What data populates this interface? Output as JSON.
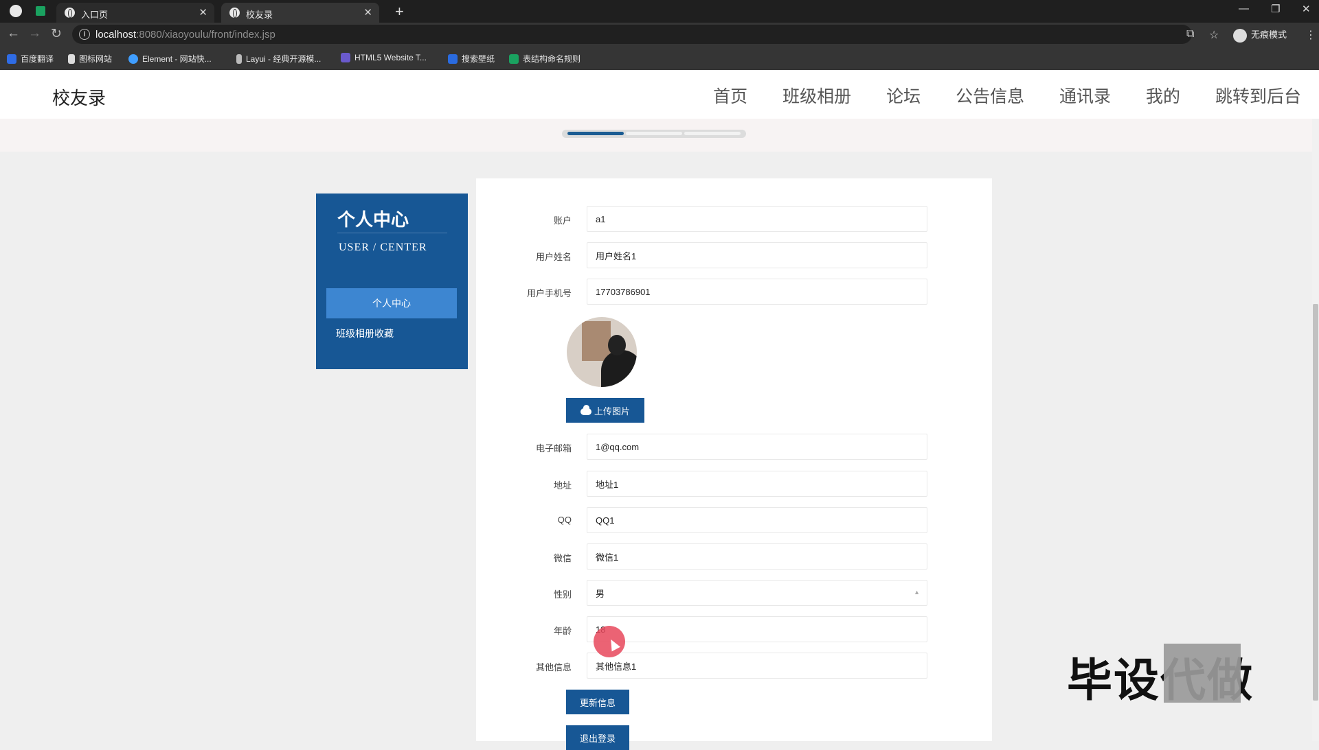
{
  "browser": {
    "tabs": [
      {
        "label": "入口页"
      },
      {
        "label": "校友录"
      }
    ],
    "new_tab_symbol": "+",
    "url_host": "localhost",
    "url_rest": ":8080/xiaoyoulu/front/index.jsp",
    "profile_label": "无痕模式",
    "bookmarks": [
      {
        "label": "百度翻译",
        "color": "#2f6ce5"
      },
      {
        "label": "图标网站",
        "color": "#ffffff"
      },
      {
        "label": "Element - 网站快...",
        "color": "#409eff"
      },
      {
        "label": "Layui - 经典开源模...",
        "color": "#ffffff"
      },
      {
        "label": "HTML5 Website T...",
        "color": "#6a5acd"
      },
      {
        "label": "搜索壁纸",
        "color": "#2a6be0"
      },
      {
        "label": "表结构命名规则",
        "color": "#1aa260"
      }
    ]
  },
  "site": {
    "logo": "校友录",
    "nav": [
      "首页",
      "班级相册",
      "论坛",
      "公告信息",
      "通讯录",
      "我的",
      "跳转到后台"
    ]
  },
  "sidebar": {
    "title": "个人中心",
    "subtitle": "USER / CENTER",
    "items": [
      {
        "label": "个人中心",
        "active": true
      },
      {
        "label": "班级相册收藏",
        "active": false
      }
    ]
  },
  "form": {
    "account": {
      "label": "账户",
      "value": "a1"
    },
    "name": {
      "label": "用户姓名",
      "value": "用户姓名1"
    },
    "phone": {
      "label": "用户手机号",
      "value": "17703786901"
    },
    "upload_label": "上传图片",
    "email": {
      "label": "电子邮箱",
      "value": "1@qq.com"
    },
    "address": {
      "label": "地址",
      "value": "地址1"
    },
    "qq": {
      "label": "QQ",
      "value": "QQ1"
    },
    "wechat": {
      "label": "微信",
      "value": "微信1"
    },
    "gender": {
      "label": "性别",
      "value": "男"
    },
    "age": {
      "label": "年龄",
      "value": "18"
    },
    "other": {
      "label": "其他信息",
      "value": "其他信息1"
    },
    "update_label": "更新信息",
    "logout_label": "退出登录"
  },
  "watermark": "毕设代做",
  "colors": {
    "primary": "#175795",
    "sidebar_active": "#3d86d1",
    "accent_click": "#e8485c"
  }
}
